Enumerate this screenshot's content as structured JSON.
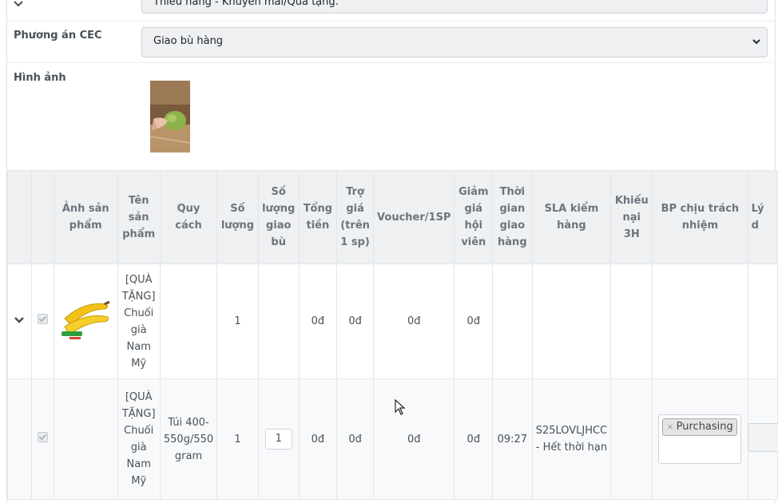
{
  "top_select": {
    "value": "Thiếu hàng - Khuyến mãi/Quà tặng."
  },
  "cec": {
    "label": "Phương án CEC",
    "value": "Giao bù hàng"
  },
  "images": {
    "label": "Hình ảnh"
  },
  "table": {
    "headers": {
      "image": "Ảnh sản phẩm",
      "name": "Tên sản phẩm",
      "spec": "Quy cách",
      "qty": "Số lượng",
      "comp_qty": "Số lượng giao bù",
      "total": "Tổng tiền",
      "subsidy": "Trợ giá (trên 1 sp)",
      "voucher": "Voucher/1SP",
      "member_discount": "Giảm giá hội viên",
      "delivery_time": "Thời gian giao hàng",
      "sla": "SLA kiểm hàng",
      "complaint": "Khiếu nại 3H",
      "responsible": "BP chịu trách nhiệm",
      "reason": "Lý d"
    },
    "rows": [
      {
        "name": "[QUÀ TẶNG] Chuối già Nam Mỹ",
        "spec": "",
        "qty": "1",
        "comp_qty": "",
        "total": "0đ",
        "subsidy": "0đ",
        "voucher": "0đ",
        "member_discount": "0đ",
        "delivery_time": "",
        "sla": "",
        "complaint": ""
      },
      {
        "name": "[QUÀ TẶNG] Chuối già Nam Mỹ",
        "spec": "Túi 400-550g/550 gram",
        "qty": "1",
        "comp_qty": "1",
        "total": "0đ",
        "subsidy": "0đ",
        "voucher": "0đ",
        "member_discount": "0đ",
        "delivery_time": "09:27",
        "sla": "S25LOVLJHCC - Hết thời hạn",
        "complaint": "",
        "responsible_tag": "Purchasing",
        "tag_remove": "×"
      }
    ]
  },
  "colors": {
    "header_bg": "#eef0f2",
    "select_bg": "#eef0f2",
    "banana": "#f2c218"
  }
}
